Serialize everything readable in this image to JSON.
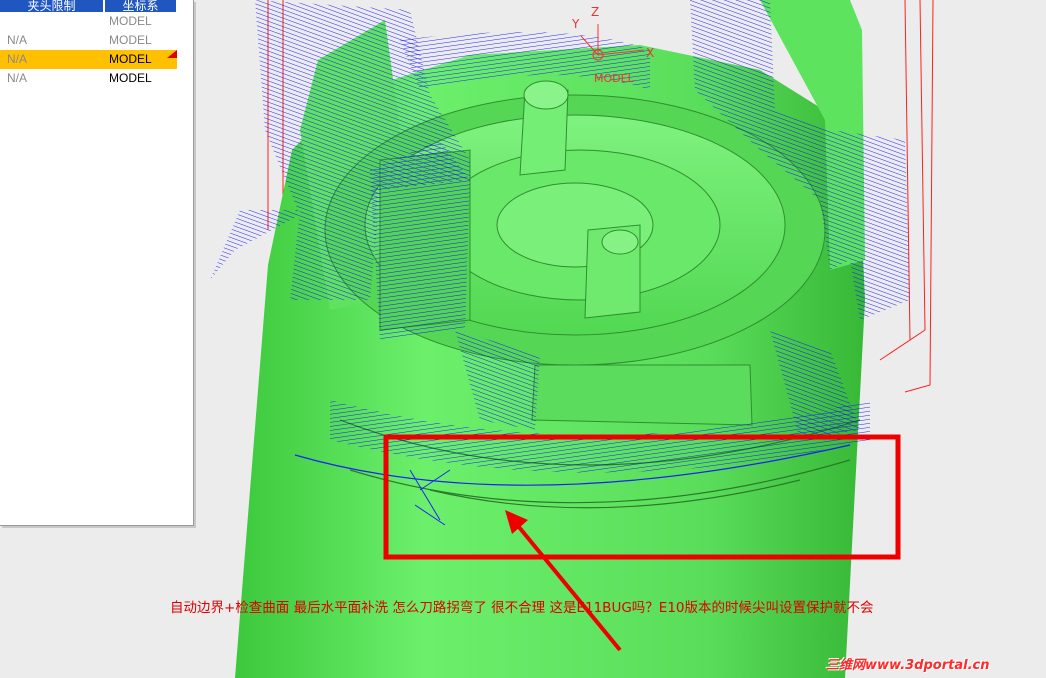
{
  "table": {
    "headers": [
      "夹头限制",
      "坐标系"
    ],
    "rows": [
      {
        "col1": "",
        "col2": "MODEL",
        "state": "normal-grey"
      },
      {
        "col1": "N/A",
        "col2": "MODEL",
        "state": "normal-grey"
      },
      {
        "col1": "N/A",
        "col2": "MODEL",
        "state": "selected"
      },
      {
        "col1": "N/A",
        "col2": "MODEL",
        "state": "normal-dark"
      }
    ]
  },
  "viewport": {
    "axes": {
      "x": "X",
      "y": "Y",
      "z": "Z",
      "origin_label": "MODEL"
    },
    "colors": {
      "model": "#6bea6b",
      "toolpath": "#1a1aff",
      "boundary": "#ff0000",
      "annotation": "#e00000"
    }
  },
  "annotation": {
    "text": "自动边界+检查曲面 最后水平面补洗 怎么刀路拐弯了 很不合理 这是E11BUG吗？E10版本的时候尖叫设置保护就不会"
  },
  "watermark": {
    "text": "三维网www.3dportal.cn"
  }
}
